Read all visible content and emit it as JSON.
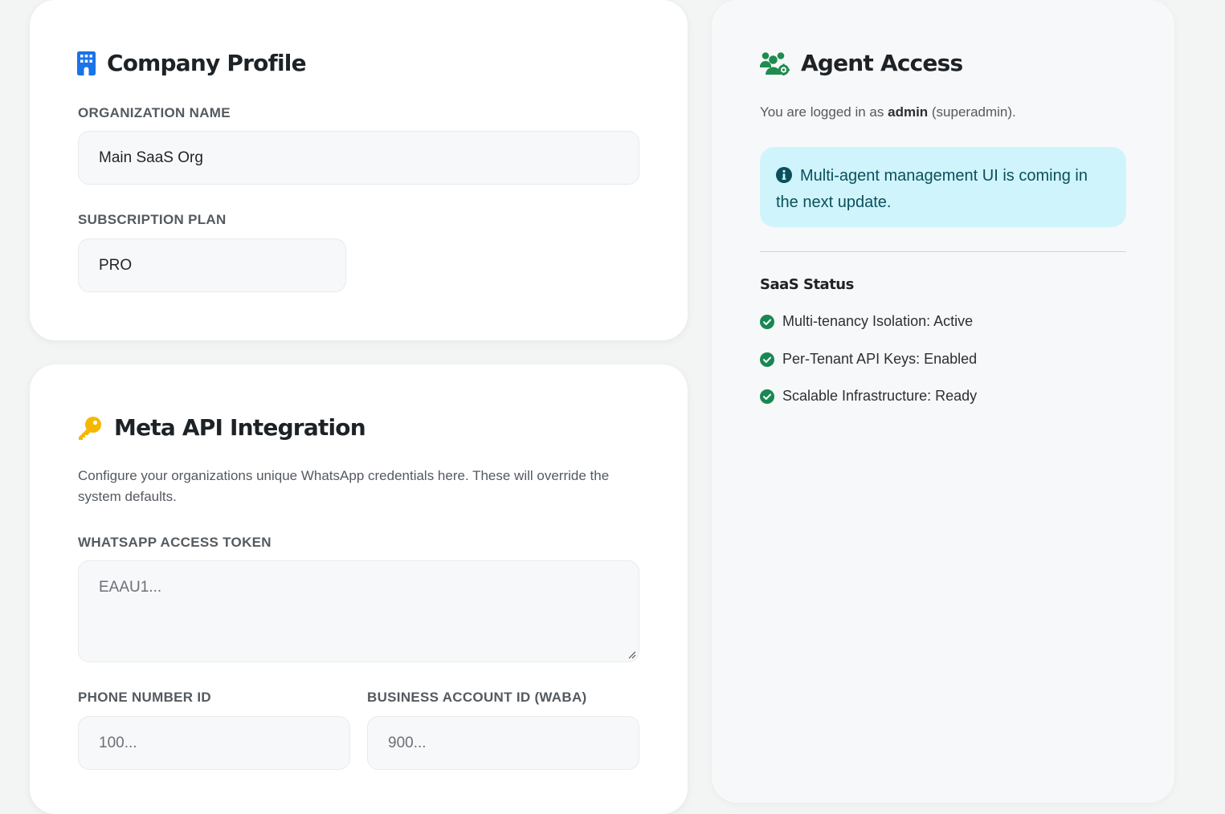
{
  "company_profile": {
    "title": "Company Profile",
    "icon": "building-icon",
    "org_name_label": "Organization Name",
    "org_name_value": "Main SaaS Org",
    "plan_label": "Subscription Plan",
    "plan_value": "PRO"
  },
  "meta_api": {
    "title": "Meta API Integration",
    "icon": "key-icon",
    "description": "Configure your organizations unique WhatsApp credentials here. These will override the system defaults.",
    "token_label": "WhatsApp Access Token",
    "token_placeholder": "EAAU1...",
    "phone_id_label": "Phone Number ID",
    "phone_id_placeholder": "100...",
    "waba_label": "Business Account ID (WABA)",
    "waba_placeholder": "900..."
  },
  "agent_access": {
    "title": "Agent Access",
    "icon": "users-gear-icon",
    "logged_prefix": "You are logged in as ",
    "username": "admin",
    "role": " (superadmin).",
    "info_message": "Multi-agent management UI is coming in the next update.",
    "status_title": "SaaS Status",
    "status_items": [
      {
        "label": "Multi-tenancy Isolation: Active"
      },
      {
        "label": "Per-Tenant API Keys: Enabled"
      },
      {
        "label": "Scalable Infrastructure: Ready"
      }
    ]
  },
  "colors": {
    "page_bg": "#f3f4f4",
    "building_icon": "#1a73e8",
    "key_icon": "#f5b800",
    "agent_icon": "#1e8c4e",
    "success": "#198754",
    "info_bg": "#cff4fc",
    "info_text": "#0b4f5c"
  }
}
